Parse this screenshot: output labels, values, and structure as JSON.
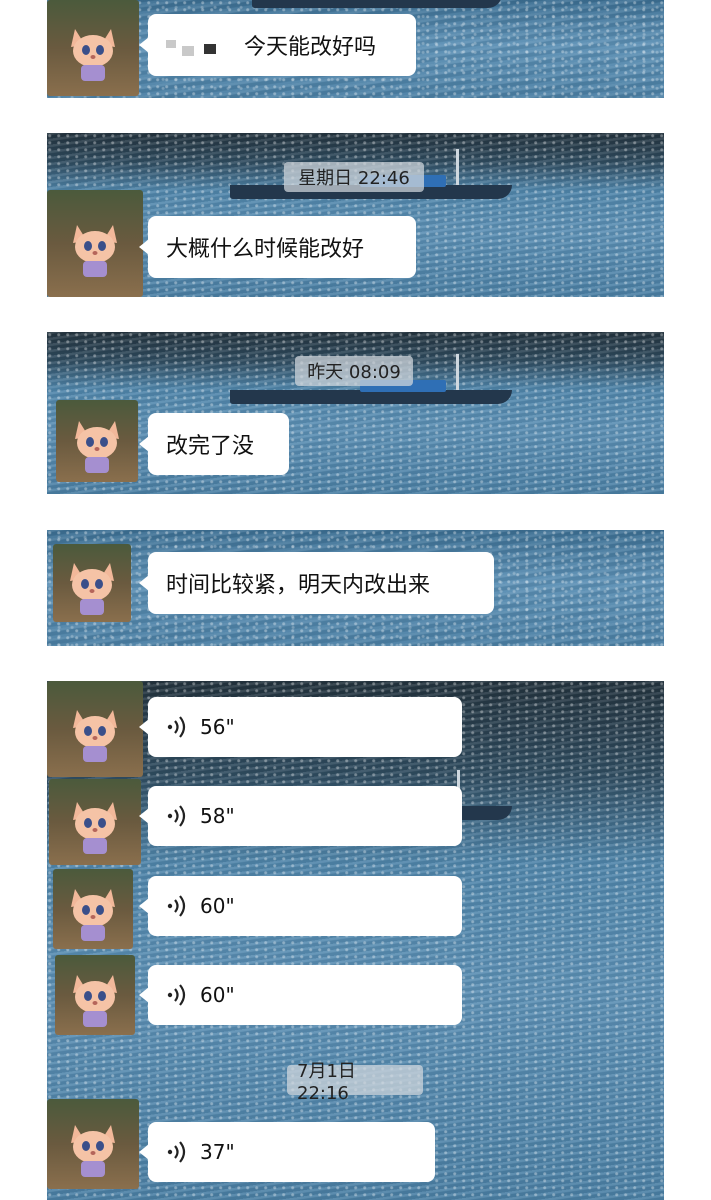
{
  "messages": [
    {
      "text": "今天能改好吗",
      "type": "text"
    },
    {
      "time": "星期日 22:46",
      "text": "大概什么时候能改好",
      "type": "text"
    },
    {
      "time": "昨天 08:09",
      "text": "改完了没",
      "type": "text"
    },
    {
      "text": "时间比较紧，明天内改出来",
      "type": "text"
    },
    {
      "voice": [
        "56\"",
        "58\"",
        "60\"",
        "60\""
      ],
      "type": "voice-group"
    },
    {
      "time": "7月1日 22:16",
      "voice": "37\"",
      "type": "voice"
    }
  ],
  "icons": {
    "avatar": "fox-avatar-icon",
    "voice": "voice-wave-icon"
  },
  "colors": {
    "bubble": "#ffffff",
    "stamp_bg": "#d2d8de",
    "water": "#5b8fb4"
  }
}
